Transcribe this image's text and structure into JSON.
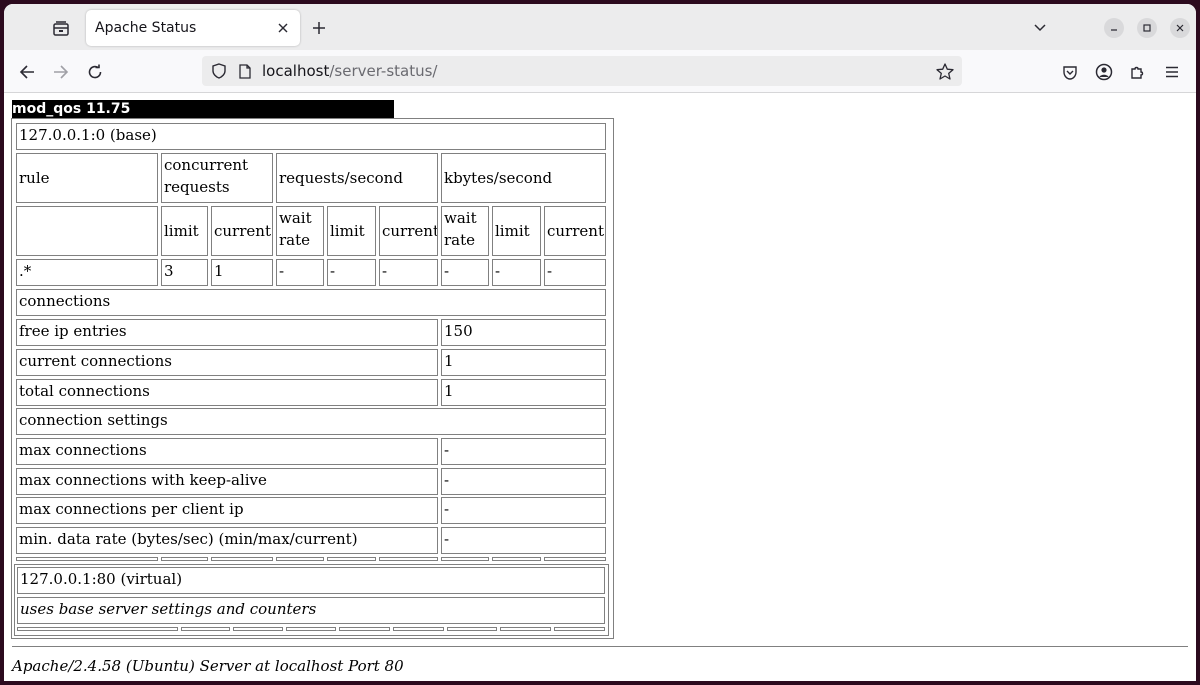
{
  "browser": {
    "tab_title": "Apache Status",
    "url_host": "localhost",
    "url_path": "/server-status/"
  },
  "page": {
    "module_title": "mod_qos 11.75",
    "base_server": {
      "header": "127.0.0.1:0 (base)",
      "columns": {
        "rule": "rule",
        "concurrent": "concurrent requests",
        "reqs": "requests/second",
        "kbytes": "kbytes/second"
      },
      "subcolumns": [
        "limit",
        "current",
        "wait rate",
        "limit",
        "current",
        "wait rate",
        "limit",
        "current"
      ],
      "rule_row": [
        ".*",
        "3",
        "1",
        "-",
        "-",
        "-",
        "-",
        "-",
        "-"
      ],
      "connections_header": "connections",
      "connections": [
        {
          "label": "free ip entries",
          "value": "150"
        },
        {
          "label": "current connections",
          "value": "1"
        },
        {
          "label": "total connections",
          "value": "1"
        }
      ],
      "settings_header": "connection settings",
      "settings": [
        {
          "label": "max connections",
          "value": "-"
        },
        {
          "label": "max connections with keep-alive",
          "value": "-"
        },
        {
          "label": "max connections per client ip",
          "value": "-"
        },
        {
          "label": "min. data rate (bytes/sec) (min/max/current)",
          "value": "-"
        }
      ]
    },
    "virtual_server": {
      "header": "127.0.0.1:80 (virtual)",
      "note": "uses base server settings and counters"
    },
    "footer": "Apache/2.4.58 (Ubuntu) Server at localhost Port 80"
  }
}
